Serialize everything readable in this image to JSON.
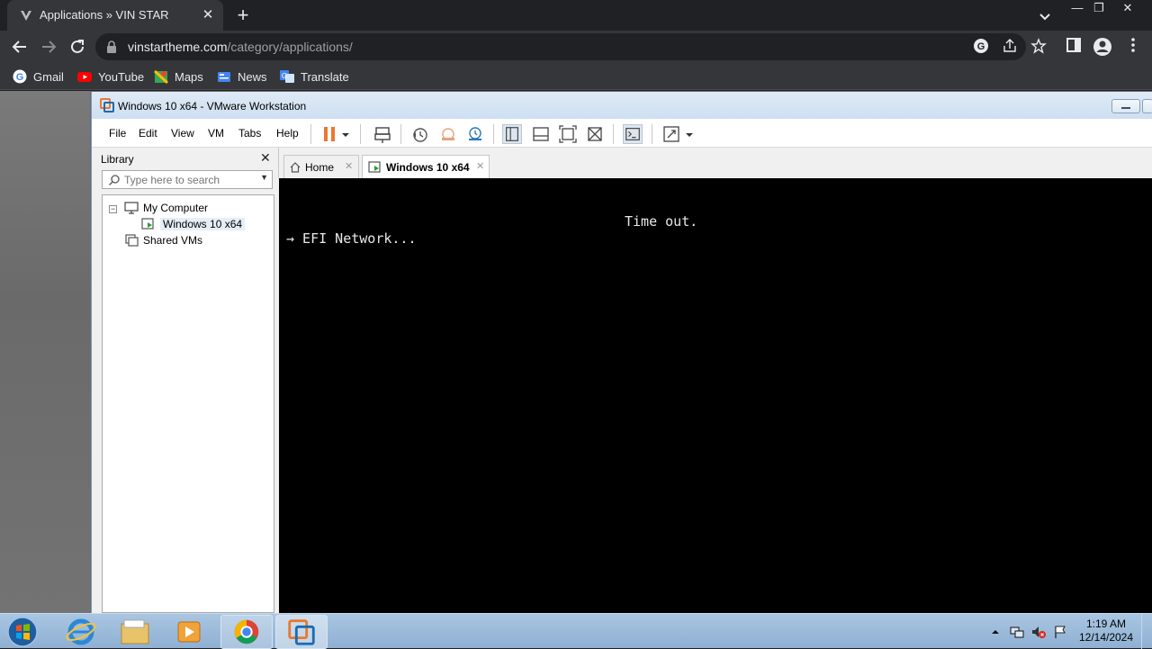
{
  "browser": {
    "tab_title": "Applications » VIN STAR",
    "tab_close": "✕",
    "new_tab": "+",
    "url_host": "vinstartheme.com",
    "url_path": "/category/applications/",
    "bookmarks": [
      {
        "label": "Gmail",
        "icon": "google-icon"
      },
      {
        "label": "YouTube",
        "icon": "youtube-icon"
      },
      {
        "label": "Maps",
        "icon": "maps-icon"
      },
      {
        "label": "News",
        "icon": "news-icon"
      },
      {
        "label": "Translate",
        "icon": "translate-icon"
      }
    ]
  },
  "vmware": {
    "window_title": "Windows 10 x64 - VMware Workstation",
    "menu": [
      "File",
      "Edit",
      "View",
      "VM",
      "Tabs",
      "Help"
    ],
    "library": {
      "title": "Library",
      "close": "✕",
      "search_placeholder": "Type here to search",
      "tree": [
        {
          "label": "My Computer",
          "toggle": "−"
        },
        {
          "label": "Windows 10 x64"
        },
        {
          "label": "Shared VMs"
        }
      ]
    },
    "tabs": [
      {
        "label": "Home",
        "close": "✕"
      },
      {
        "label": "Windows 10 x64",
        "close": "✕"
      }
    ],
    "console": {
      "line1": "Time out.",
      "line2": "→ EFI Network..."
    },
    "accent_color": "#e8792f"
  },
  "taskbar": {
    "time": "1:19 AM",
    "date": "12/14/2024",
    "apps": [
      "start-orb-icon",
      "internet-explorer-icon",
      "file-explorer-icon",
      "media-player-icon",
      "chrome-icon",
      "vmware-icon"
    ]
  }
}
